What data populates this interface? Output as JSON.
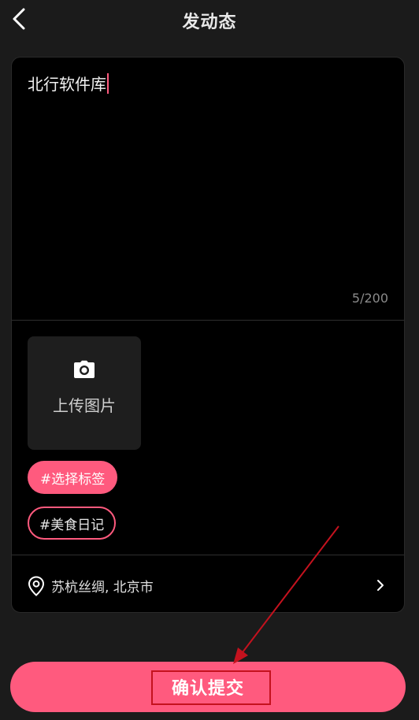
{
  "header": {
    "title": "发动态",
    "back_icon": "chevron-left-icon"
  },
  "editor": {
    "text": "北行软件库",
    "char_count": "5/200",
    "caret_color": "#ff5a7e"
  },
  "upload": {
    "icon": "camera-icon",
    "label": "上传图片"
  },
  "tags": {
    "select_label": "#选择标签",
    "chips": [
      "#美食日记"
    ]
  },
  "location": {
    "icon": "location-pin-icon",
    "text": "苏杭丝绸, 北京市",
    "chevron_icon": "chevron-right-icon"
  },
  "submit": {
    "label": "确认提交"
  },
  "colors": {
    "accent": "#ff5a7e",
    "background": "#1b1b1b",
    "card": "#000000",
    "annotation": "#c4121e"
  }
}
